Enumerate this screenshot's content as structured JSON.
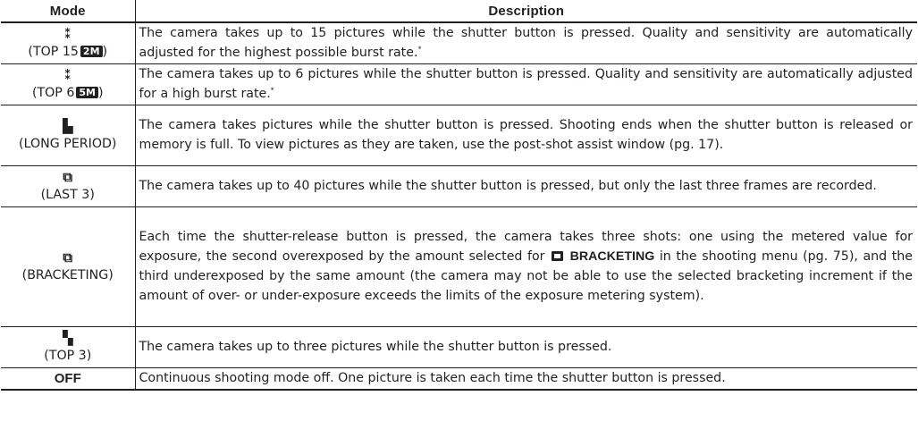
{
  "table": {
    "headers": {
      "mode": "Mode",
      "description": "Description"
    },
    "rows": [
      {
        "icon": "⁑",
        "icon_name": "top-15-burst-icon",
        "mode_pre": "(TOP 15",
        "badge": "2M",
        "mode_post": ")",
        "description": "The camera takes up to 15 pictures while the shutter button is pressed.  Quality and sensitivity are automatically adjusted for the highest possible burst rate.",
        "note_mark": "*"
      },
      {
        "icon": "⁑",
        "icon_name": "top-6-burst-icon",
        "mode_pre": "(TOP 6",
        "badge": "5M",
        "mode_post": ")",
        "description": "The camera takes up to 6 pictures while the shutter button is pressed.  Quality and sensitivity are automatically adjusted for a high burst rate.",
        "note_mark": "*"
      },
      {
        "icon": "▙",
        "icon_name": "long-period-icon",
        "mode": "(LONG PERIOD)",
        "description": "The camera takes pictures while the shutter button is pressed.  Shooting ends when the shutter button is released or memory is full.  To view pictures as they are taken, use the post-shot assist window (pg. 17)."
      },
      {
        "icon": "⧉",
        "icon_name": "last-3-icon",
        "mode": "(LAST 3)",
        "description": "The camera takes up to 40 pictures while the shutter button is pressed, but only the last three frames are recorded."
      },
      {
        "icon": "⧉",
        "icon_name": "bracketing-icon",
        "mode": "(BRACKETING)",
        "desc_pre": "Each time the shutter-release button is pressed, the camera takes three shots: one using the metered value for exposure, the second overexposed by the amount selected for",
        "desc_strong": "BRACKETING",
        "desc_post": "in the shooting menu (pg. 75), and the third underexposed by the same amount (the camera may not be able to use the selected bracketing increment if the amount of over- or under-exposure exceeds the limits of the exposure metering system)."
      },
      {
        "icon": "▚",
        "icon_name": "top-3-icon",
        "mode": "(TOP 3)",
        "description": "The camera takes up to three pictures while the shutter button is pressed."
      },
      {
        "mode": "OFF",
        "description": "Continuous shooting mode off.  One picture is taken each time the shutter button is pressed."
      }
    ]
  }
}
